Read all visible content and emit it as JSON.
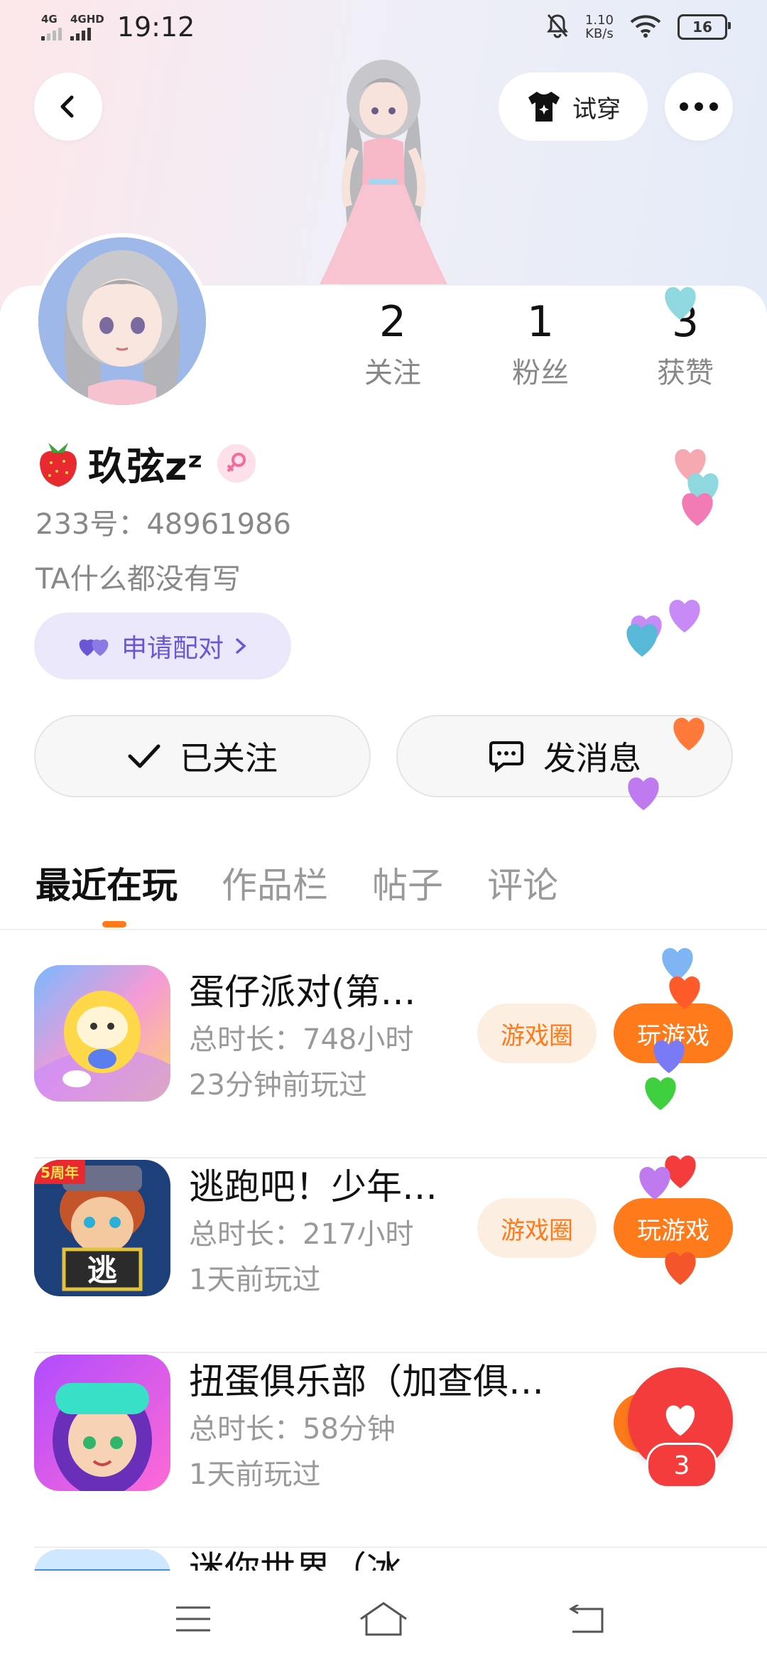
{
  "status_bar": {
    "network1": "4G",
    "network2": "4GHD",
    "time": "19:12",
    "speed_value": "1.10",
    "speed_unit": "KB/s",
    "battery": "16"
  },
  "header": {
    "try_on_label": "试穿"
  },
  "profile": {
    "stats": [
      {
        "value": "2",
        "label": "关注"
      },
      {
        "value": "1",
        "label": "粉丝"
      },
      {
        "value": "3",
        "label": "获赞"
      }
    ],
    "name": "玖弦",
    "name_suffix": "zᶻ",
    "uid": "233号：48961986",
    "bio": "TA什么都没有写",
    "pair_label": "申请配对",
    "follow_label": "已关注",
    "message_label": "发消息"
  },
  "tabs": [
    "最近在玩",
    "作品栏",
    "帖子",
    "评论"
  ],
  "games": [
    {
      "title": "蛋仔派对(第…",
      "duration": "总时长：748小时",
      "last_played": "23分钟前玩过",
      "circle_label": "游戏圈",
      "play_label": "玩游戏"
    },
    {
      "title": "逃跑吧！少年…",
      "duration": "总时长：217小时",
      "last_played": "1天前玩过",
      "circle_label": "游戏圈",
      "play_label": "玩游戏",
      "badge": "5周年",
      "icon_text": "逃"
    },
    {
      "title": "扭蛋俱乐部（加查俱…",
      "duration": "总时长：58分钟",
      "last_played": "1天前玩过"
    },
    {
      "title": "迷你世界（冰…"
    }
  ],
  "like_count": "3",
  "colors": {
    "accent": "#ff7a1a",
    "pair": "#6b57d6",
    "like": "#f43c3c"
  }
}
